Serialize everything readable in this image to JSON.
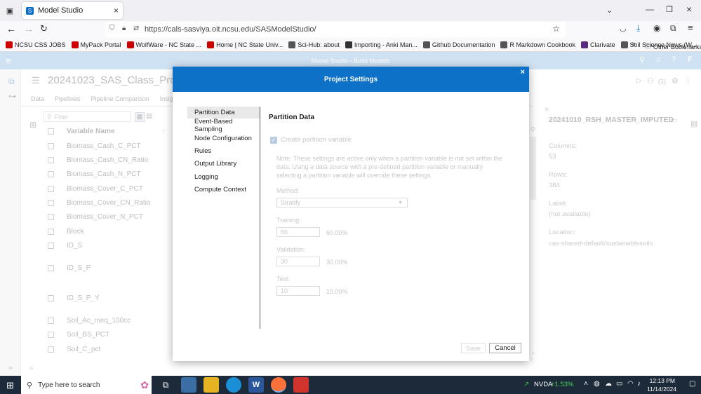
{
  "browser": {
    "tab_title": "Model Studio",
    "url": "https://cals-sasviya.oit.ncsu.edu/SASModelStudio/",
    "url_domain": "ncsu.edu",
    "bookmarks": [
      {
        "label": "NCSU CSS JOBS",
        "color": "#cc0000"
      },
      {
        "label": "MyPack Portal",
        "color": "#cc0000"
      },
      {
        "label": "WolfWare - NC State ...",
        "color": "#cc0000"
      },
      {
        "label": "Home | NC State Univ...",
        "color": "#cc0000"
      },
      {
        "label": "Sci-Hub: about",
        "color": "#555555"
      },
      {
        "label": "Importing - Anki Man...",
        "color": "#333333"
      },
      {
        "label": "Github Documentation",
        "color": "#555555"
      },
      {
        "label": "R Markdown Cookbook",
        "color": "#555555"
      },
      {
        "label": "Clarivate",
        "color": "#5a2a82"
      },
      {
        "label": "Soil Science News (W...",
        "color": "#555555"
      }
    ],
    "other_bookmarks": "Other Bookmarks"
  },
  "app": {
    "header_title": "Model Studio - Build Models",
    "project_title": "20241023_SAS_Class_Project_Ro",
    "tabs": [
      "Data",
      "Pipelines",
      "Pipeline Comparison",
      "Insights"
    ],
    "filter_placeholder": "Filter",
    "variable_col_header": "Variable Name",
    "variables": [
      "Biomass_Cash_C_PCT",
      "Biomass_Cash_CN_Ratio",
      "Biomass_Cash_N_PCT",
      "Biomass_Cover_C_PCT",
      "Biomass_Cover_CN_Ratio",
      "Biomass_Cover_N_PCT",
      "Block",
      "ID_S",
      "ID_S_P",
      "ID_S_P_Y",
      "Soil_Ac_meq_100cc",
      "Soil_BS_PCT",
      "Soil_C_pct"
    ],
    "user_initial": "F",
    "count_badge": "(1)"
  },
  "right_panel": {
    "dataset_name": "20241010_RSH_MASTER_IMPUTED",
    "columns_label": "Columns:",
    "columns_value": "53",
    "rows_label": "Rows:",
    "rows_value": "384",
    "label_label": "Label:",
    "label_value": "(not available)",
    "location_label": "Location:",
    "location_value": "cas-shared-default/sustainablesoils"
  },
  "modal": {
    "title": "Project Settings",
    "close": "×",
    "nav_items": [
      "Partition Data",
      "Event-Based Sampling",
      "Node Configuration",
      "Rules",
      "Output Library",
      "Logging",
      "Compute Context"
    ],
    "selected_nav": "Partition Data",
    "section_title": "Partition Data",
    "checkbox_label": "Create partition variable",
    "note": "Note: These settings are active only when a partition variable is not set within the data. Using a data source with a pre-defined partition variable or manually selecting a partition variable will override these settings.",
    "method_label": "Method:",
    "method_value": "Stratify",
    "training_label": "Training:",
    "training_value": "60",
    "training_pct": "60.00%",
    "validation_label": "Validation:",
    "validation_value": "30",
    "validation_pct": "30.00%",
    "test_label": "Test:",
    "test_value": "10",
    "test_pct": "10.00%",
    "save_label": "Save",
    "cancel_label": "Cancel"
  },
  "taskbar": {
    "search_placeholder": "Type here to search",
    "stock_name": "NVDA",
    "stock_change": "+1.53%",
    "time": "12:13 PM",
    "date": "11/14/2024"
  }
}
